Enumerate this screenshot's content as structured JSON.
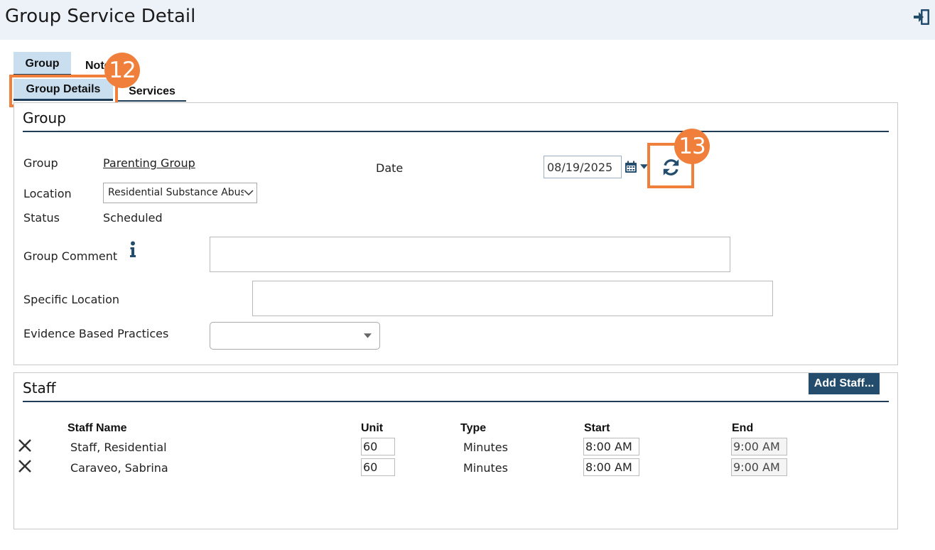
{
  "header": {
    "title": "Group Service Detail"
  },
  "tabs": {
    "group": "Group",
    "notes": "Note",
    "group_details": "Group Details",
    "services": "Services"
  },
  "callouts": {
    "step_12": "12",
    "step_13": "13"
  },
  "group_panel": {
    "title": "Group",
    "group_label": "Group",
    "group_value": "Parenting Group",
    "date_label": "Date",
    "date_value": "08/19/2025",
    "location_label": "Location",
    "location_value": "Residential Substance Abuse",
    "status_label": "Status",
    "status_value": "Scheduled",
    "group_comment_label": "Group Comment",
    "specific_location_label": "Specific Location",
    "ebp_label": "Evidence Based Practices"
  },
  "staff_panel": {
    "title": "Staff",
    "add_staff_label": "Add Staff...",
    "columns": [
      "Staff Name",
      "Unit",
      "Type",
      "Start",
      "End"
    ],
    "rows": [
      {
        "name": "Staff, Residential",
        "unit": "60",
        "type": "Minutes",
        "start": "8:00 AM",
        "end": "9:00 AM"
      },
      {
        "name": "Caraveo, Sabrina",
        "unit": "60",
        "type": "Minutes",
        "start": "8:00 AM",
        "end": "9:00 AM"
      }
    ]
  },
  "icons": [
    "exit-icon",
    "calendar-icon",
    "caret-down-icon",
    "refresh-icon",
    "info-icon",
    "chevron-down-icon",
    "delete-icon"
  ],
  "colors": {
    "accent": "#f07f3c",
    "navy": "#1f3c58",
    "button": "#244d6d",
    "tab": "#c9deef",
    "header": "#edf2f8"
  }
}
